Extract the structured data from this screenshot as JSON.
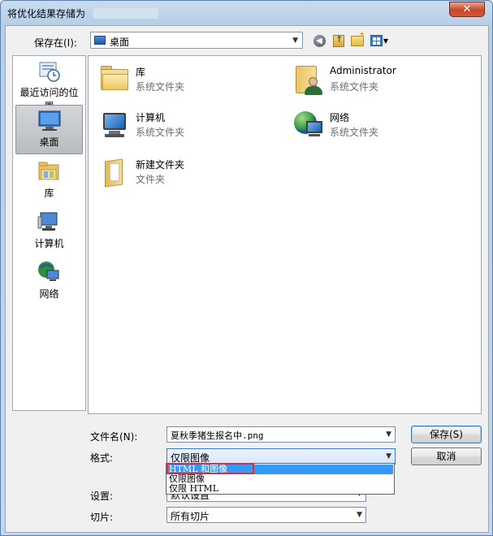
{
  "window": {
    "title": "将优化结果存储为",
    "close_glyph": "✕"
  },
  "toolbar": {
    "save_in_label": "保存在(I):",
    "location": "桌面",
    "icons": [
      "back-icon",
      "up-folder-icon",
      "new-folder-icon",
      "view-menu-icon"
    ]
  },
  "places": [
    {
      "label": "最近访问的位置",
      "icon": "recent-places-icon",
      "selected": false
    },
    {
      "label": "桌面",
      "icon": "desktop-icon",
      "selected": true
    },
    {
      "label": "库",
      "icon": "libraries-icon",
      "selected": false
    },
    {
      "label": "计算机",
      "icon": "computer-icon",
      "selected": false
    },
    {
      "label": "网络",
      "icon": "network-icon",
      "selected": false
    }
  ],
  "items": [
    {
      "name": "库",
      "type": "系统文件夹",
      "icon": "libraries-folder-icon"
    },
    {
      "name": "Administrator",
      "type": "系统文件夹",
      "icon": "user-folder-icon"
    },
    {
      "name": "计算机",
      "type": "系统文件夹",
      "icon": "computer-icon"
    },
    {
      "name": "网络",
      "type": "系统文件夹",
      "icon": "network-icon"
    },
    {
      "name": "新建文件夹",
      "type": "文件夹",
      "icon": "new-folder-icon"
    }
  ],
  "form": {
    "filename_label": "文件名(N):",
    "filename_value": "夏秋季猪生报名中.png",
    "format_label": "格式:",
    "format_value": "仅限图像",
    "format_options": [
      "HTML 和图像",
      "仅限图像",
      "仅限 HTML"
    ],
    "format_highlighted_index": 0,
    "settings_label": "设置:",
    "settings_value": "默认设置",
    "slices_label": "切片:",
    "slices_value": "所有切片",
    "save_button": "保存(S)",
    "cancel_button": "取消"
  },
  "colors": {
    "highlight": "#3399ff",
    "annotation_box": "#d9303a"
  }
}
